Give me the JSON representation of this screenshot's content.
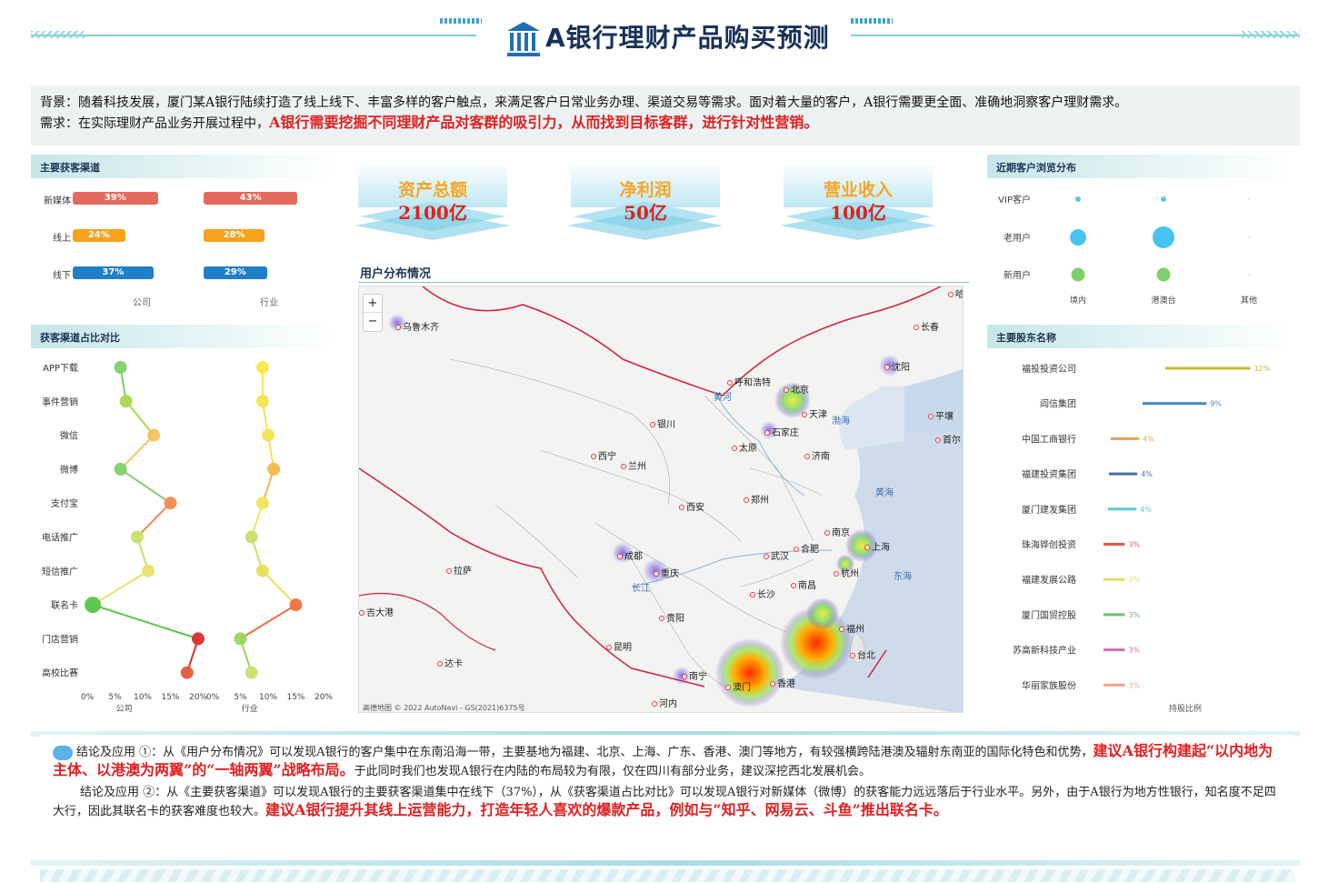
{
  "header": {
    "title": "A银行理财产品购买预测"
  },
  "background": {
    "line1": "背景：随着科技发展，厦门某A银行陆续打造了线上线下、丰富多样的客户触点，来满足客户日常业务办理、渠道交易等需求。面对着大量的客户，A银行需要更全面、准确地洞察客户理财需求。",
    "line2_prefix": "需求：在实际理财产品业务开展过程中，",
    "line2_highlight": "A银行需要挖掘不同理财产品对客群的吸引力，从而找到目标客群，进行针对性营销。"
  },
  "panels": {
    "channels": "主要获客渠道",
    "ratio": "获客渠道占比对比",
    "browse": "近期客户浏览分布",
    "shareholders": "主要股东名称",
    "map": "用户分布情况"
  },
  "kpis": [
    {
      "name": "资产总额",
      "value": "2100亿"
    },
    {
      "name": "净利润",
      "value": "50亿"
    },
    {
      "name": "营业收入",
      "value": "100亿"
    }
  ],
  "chart_data": [
    {
      "type": "bar",
      "title": "主要获客渠道",
      "categories": [
        "新媒体",
        "线上",
        "线下"
      ],
      "groups": [
        "公司",
        "行业"
      ],
      "series": [
        {
          "name": "公司",
          "values": [
            39,
            24,
            37
          ]
        },
        {
          "name": "行业",
          "values": [
            43,
            28,
            29
          ]
        }
      ],
      "labels": {
        "公司": [
          "39%",
          "24%",
          "37%"
        ],
        "行业": [
          "43%",
          "28%",
          "29%"
        ]
      },
      "colors": [
        "#e36a5c",
        "#f6a21c",
        "#1f7fc7"
      ]
    },
    {
      "type": "line",
      "title": "获客渠道占比对比",
      "categories": [
        "APP下载",
        "事件营销",
        "微信",
        "微博",
        "支付宝",
        "电话推广",
        "短信推广",
        "联名卡",
        "门店营销",
        "高校比赛"
      ],
      "series": [
        {
          "name": "公司",
          "values": [
            6,
            7,
            12,
            6,
            15,
            9,
            11,
            1,
            20,
            18
          ]
        },
        {
          "name": "行业",
          "values": [
            9,
            9,
            10,
            11,
            9,
            7,
            9,
            15,
            5,
            7
          ]
        }
      ],
      "xticks": [
        "0%",
        "5%",
        "10%",
        "15%",
        "20%"
      ],
      "xlabels": [
        "公司",
        "行业"
      ],
      "xlim": [
        0,
        20
      ]
    },
    {
      "type": "scatter",
      "title": "近期客户浏览分布",
      "rows": [
        "VIP客户",
        "老用户",
        "新用户"
      ],
      "cols": [
        "境内",
        "港澳台",
        "其他"
      ],
      "values": [
        [
          2,
          2,
          0.3
        ],
        [
          6,
          8,
          0.3
        ],
        [
          5,
          5,
          0.3
        ]
      ],
      "colors": [
        "#5bc8e8",
        "#48c3f0",
        "#7fd06a"
      ]
    },
    {
      "type": "bar",
      "title": "主要股东名称",
      "categories": [
        "福投投资公司",
        "阎信集团",
        "中国工商银行",
        "福建投资集团",
        "厦门建发集团",
        "珠海铧创投资",
        "福建发展公路",
        "厦门国贸控股",
        "苏高新科技产业",
        "华丽家族股份"
      ],
      "values": [
        12,
        9,
        4,
        4,
        4,
        3,
        3,
        3,
        3,
        3
      ],
      "labels": [
        "12%",
        "9%",
        "4%",
        "4%",
        "4%",
        "3%",
        "3%",
        "3%",
        "3%",
        "3%"
      ],
      "xlabel": "持股比例",
      "colors": [
        "#c9b83a",
        "#4a86c5",
        "#f4a04a",
        "#4a6fa5",
        "#5bc8d0",
        "#e05a4e",
        "#e6d86a",
        "#6cc070",
        "#d36fb5",
        "#f0a090"
      ]
    }
  ],
  "map": {
    "zoom_in": "+",
    "zoom_out": "−",
    "attribution": "高德地图 © 2022 AutoNavi - GS(2021)6375号",
    "cities": [
      "乌鲁木齐",
      "长春",
      "沈阳",
      "呼和浩特",
      "北京",
      "天津",
      "黄河",
      "渤海",
      "银川",
      "石家庄",
      "太原",
      "济南",
      "平壤",
      "首尔",
      "西宁",
      "兰州",
      "黄海",
      "郑州",
      "西安",
      "南京",
      "上海",
      "合肥",
      "成都",
      "武汉",
      "拉萨",
      "重庆",
      "杭州",
      "东海",
      "长江",
      "南昌",
      "长沙",
      "福州",
      "贵阳",
      "台北",
      "昆明",
      "南宁",
      "香港",
      "澳门",
      "河内",
      "达卡",
      "吉大港",
      "哈尔滨"
    ]
  },
  "conclusion": {
    "p1_prefix": "结论及应用 ①：从《用户分布情况》可以发现A银行的客户集中在东南沿海一带，主要基地为福建、北京、上海、广东、香港、澳门等地方，有较强横跨陆港澳及辐射东南亚的国际化特色和优势，",
    "p1_highlight": "建议A银行构建起“以内地为主体、以港澳为两翼”的“一轴两翼”战略布局。",
    "p1_suffix": "于此同时我们也发现A银行在内陆的布局较为有限，仅在四川有部分业务，建议深挖西北发展机会。",
    "p2_prefix": "结论及应用 ②：从《主要获客渠道》可以发现A银行的主要获客渠道集中在线下（37%），从《获客渠道占比对比》可以发现A银行对新媒体（微博）的获客能力远远落后于行业水平。另外，由于A银行为地方性银行，知名度不足四大行，因此其联名卡的获客难度也较大。",
    "p2_highlight": "建议A银行提升其线上运营能力，打造年轻人喜欢的爆款产品，例如与“知乎、网易云、斗鱼”推出联名卡。"
  }
}
